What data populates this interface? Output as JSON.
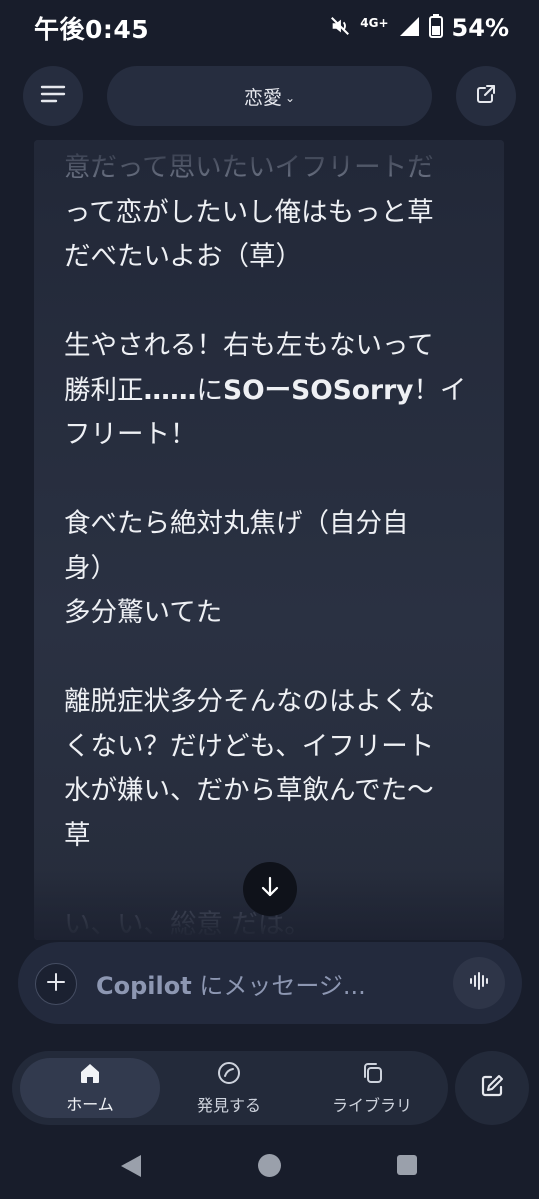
{
  "status_bar": {
    "time": "午後0:45",
    "network": "4G+",
    "battery": "54%"
  },
  "header": {
    "title": "恋愛",
    "menu_icon": "hamburger-icon",
    "share_icon": "share-icon"
  },
  "message": {
    "line_top_faded": "意だって思いたいイフリートだ",
    "para1_rest": "って恋がしたいし俺はもっと草\nだべたいよお（草）",
    "para2_a": "生やされる！右も左もないって\n勝利正",
    "para2_bold1": "……",
    "para2_b": "に",
    "para2_bold2": "SOーSOSorry",
    "para2_c": "！イ\nフリート！",
    "para3": "食べたら絶対丸焦げ（自分自\n身）\n多分驚いてた",
    "para4": "離脱症状多分そんなのはよくな\nくない？だけども、イフリート\n水が嫌い、だから草飲んでた〜\n草",
    "line_bottom_faded": "い、い、総意 だは。"
  },
  "composer": {
    "brand": "Copilot",
    "placeholder_rest": " にメッセージ..."
  },
  "bottom_nav": {
    "home": "ホーム",
    "discover": "発見する",
    "library": "ライブラリ"
  },
  "colors": {
    "background": "#181d2b",
    "card": "#2a3142",
    "pill": "#262d3f"
  }
}
